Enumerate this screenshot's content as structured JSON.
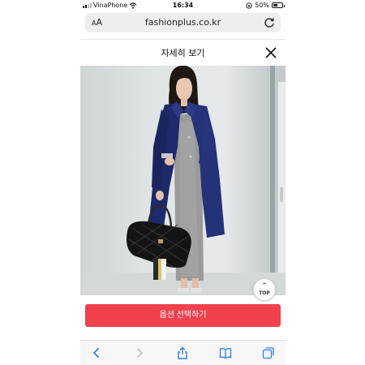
{
  "status_bar": {
    "carrier": "VinaPhone",
    "time": "16:34",
    "battery_percent": "50%",
    "battery_level": 0.5
  },
  "browser": {
    "text_size_label_small": "A",
    "text_size_label_large": "A",
    "url": "fashionplus.co.kr"
  },
  "modal": {
    "title": "자세히 보기"
  },
  "scroll_top": {
    "label": "TOP"
  },
  "option_button": {
    "label": "옵션 선택하기",
    "color": "#f0414d"
  },
  "toolbar": {
    "icons": [
      "back-icon",
      "forward-icon",
      "share-icon",
      "bookmarks-icon",
      "tabs-icon"
    ],
    "accent": "#2f7cf6"
  }
}
